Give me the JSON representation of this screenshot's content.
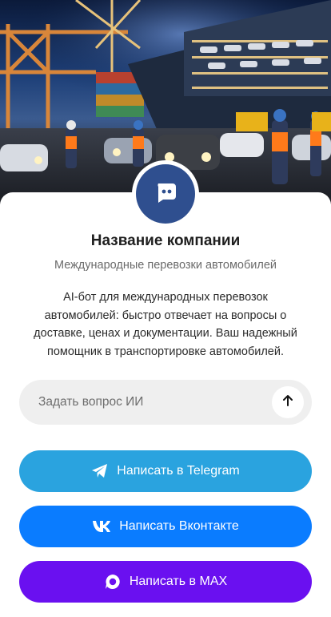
{
  "profile": {
    "avatar_icon": "chat-bubble-icon",
    "company_name": "Название компании",
    "subtitle": "Международные перевозки автомобилей",
    "description": "AI-бот для международных перевозок автомобилей: быстро отвечает на вопросы о доставке, ценах и документации. Ваш надежный помощник в транспортировке автомобилей."
  },
  "ask": {
    "label": "Задать вопрос ИИ",
    "send_icon": "arrow-up-icon"
  },
  "buttons": [
    {
      "label": "Написать в Telegram",
      "icon": "telegram-icon",
      "color": "#2aa3df"
    },
    {
      "label": "Написать Вконтакте",
      "icon": "vk-icon",
      "color": "#0a7cff"
    },
    {
      "label": "Написать в MAX",
      "icon": "max-icon",
      "color": "#6a10f0"
    }
  ],
  "colors": {
    "avatar_bg": "#2f4f8f",
    "ask_bg": "#efefef"
  }
}
